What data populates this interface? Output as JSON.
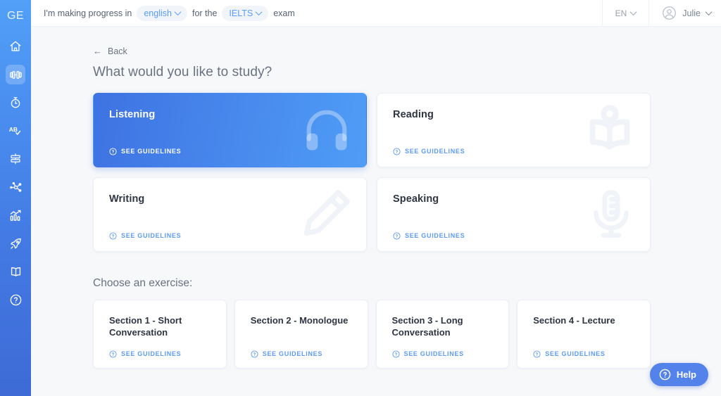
{
  "sidebar": {
    "logo": "GE",
    "items": [
      {
        "name": "home-icon",
        "label": "Home",
        "active": false
      },
      {
        "name": "dumbbell-icon",
        "label": "Practice",
        "active": true
      },
      {
        "name": "stopwatch-icon",
        "label": "Timed test",
        "active": false
      },
      {
        "name": "ab-check-icon",
        "label": "Grammar check",
        "active": false
      },
      {
        "name": "flashcards-icon",
        "label": "Flashcards",
        "active": false
      },
      {
        "name": "network-icon",
        "label": "Vocabulary network",
        "active": false
      },
      {
        "name": "bar-chart-icon",
        "label": "Statistics",
        "active": false
      },
      {
        "name": "rocket-icon",
        "label": "Boost",
        "active": false
      },
      {
        "name": "open-book-icon",
        "label": "Library",
        "active": false
      },
      {
        "name": "question-circle-icon",
        "label": "Help",
        "active": false
      }
    ]
  },
  "header": {
    "sentence_start": "I'm making progress in",
    "language_chip": "english",
    "sentence_middle": "for the",
    "exam_chip": "IELTS",
    "sentence_end": "exam",
    "language_selector": "EN",
    "user_name": "Julie"
  },
  "main": {
    "back_label": "Back",
    "back_arrow": "←",
    "page_title": "What would you like to study?",
    "guidelines_label": "SEE GUIDELINES",
    "skills": [
      {
        "name": "Listening",
        "icon": "headphones-icon",
        "active": true
      },
      {
        "name": "Reading",
        "icon": "person-reading-icon",
        "active": false
      },
      {
        "name": "Writing",
        "icon": "pencil-icon",
        "active": false
      },
      {
        "name": "Speaking",
        "icon": "microphone-icon",
        "active": false
      }
    ],
    "exercise_section_title": "Choose an exercise:",
    "exercises": [
      {
        "name": "Section 1 - Short Conversation"
      },
      {
        "name": "Section 2 - Monologue"
      },
      {
        "name": "Section 3 - Long Conversation"
      },
      {
        "name": "Section 4 - Lecture"
      }
    ]
  },
  "help": {
    "label": "Help"
  },
  "colors": {
    "brand_blue": "#5383ea",
    "accent_light_blue": "#4f9df6",
    "page_bg": "#f7f8fa",
    "text_dark": "#2f3542",
    "text_muted": "#6a7181"
  }
}
